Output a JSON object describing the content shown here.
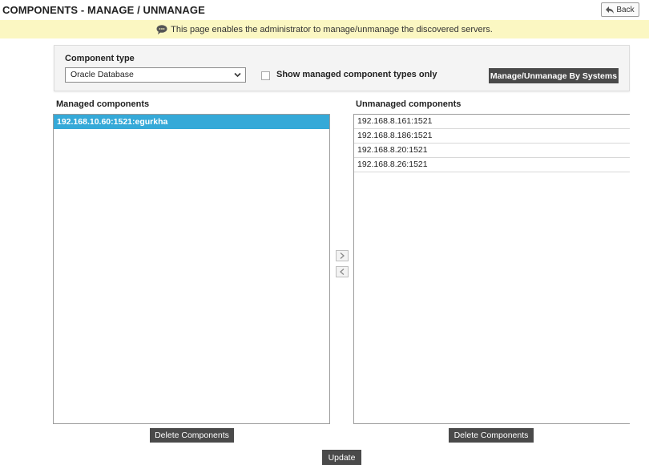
{
  "header": {
    "title": "COMPONENTS - MANAGE / UNMANAGE",
    "back_label": "Back"
  },
  "banner": {
    "message": "This page enables the administrator to manage/unmanage the discovered servers."
  },
  "filter": {
    "component_type_label": "Component type",
    "component_type_selected": "Oracle Database",
    "managed_only_label": "Show managed component types only",
    "managed_only_checked": false,
    "manage_by_systems_label": "Manage/Unmanage By Systems"
  },
  "managed": {
    "heading": "Managed components",
    "items": [
      "192.168.10.60:1521:egurkha"
    ],
    "selected_index": 0,
    "delete_label": "Delete Components"
  },
  "unmanaged": {
    "heading": "Unmanaged components",
    "items": [
      "192.168.8.161:1521",
      "192.168.8.186:1521",
      "192.168.8.20:1521",
      "192.168.8.26:1521"
    ],
    "delete_label": "Delete Components"
  },
  "actions": {
    "update_label": "Update"
  },
  "icons": {
    "back": "back-arrow-icon",
    "banner": "speech-bubble-icon",
    "select": "chevron-down-icon",
    "move_right": "chevron-right-icon",
    "move_left": "chevron-left-icon"
  },
  "colors": {
    "banner_bg": "#fbf7c2",
    "selected_item": "#35a9d8",
    "dark_button": "#4a4a4a"
  }
}
